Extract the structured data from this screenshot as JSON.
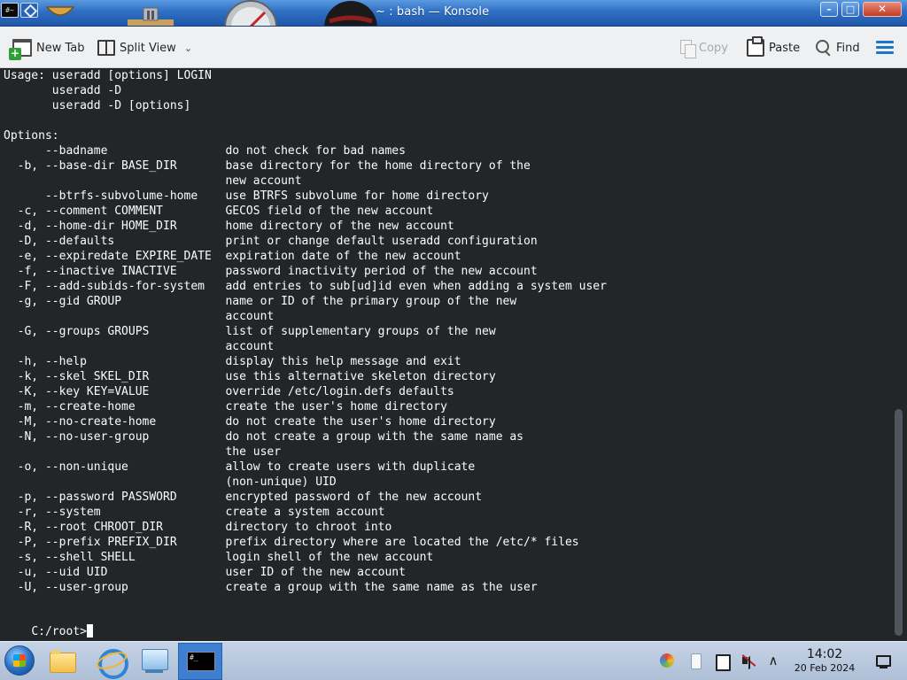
{
  "window": {
    "title": "~ : bash — Konsole",
    "menu_icon_glyph": "#~",
    "minimize_glyph": "–",
    "maximize_glyph": "□",
    "close_glyph": "✕"
  },
  "toolbar": {
    "new_tab": "New Tab",
    "split_view": "Split View",
    "copy": "Copy",
    "paste": "Paste",
    "find": "Find"
  },
  "icons": {
    "new_tab": "new-tab-icon",
    "split_view": "split-view-icon",
    "copy": "copy-icon",
    "paste": "paste-icon",
    "find": "find-icon",
    "menu": "hamburger-menu-icon"
  },
  "colors": {
    "terminal_bg": "#232629",
    "terminal_fg": "#fcfcfc",
    "titlebar_blue": "#2f6fc4",
    "menu_accent": "#1d74c8"
  },
  "terminal": {
    "lines": [
      "Usage: useradd [options] LOGIN",
      "       useradd -D",
      "       useradd -D [options]",
      "",
      "Options:",
      "      --badname                 do not check for bad names",
      "  -b, --base-dir BASE_DIR       base directory for the home directory of the",
      "                                new account",
      "      --btrfs-subvolume-home    use BTRFS subvolume for home directory",
      "  -c, --comment COMMENT         GECOS field of the new account",
      "  -d, --home-dir HOME_DIR       home directory of the new account",
      "  -D, --defaults                print or change default useradd configuration",
      "  -e, --expiredate EXPIRE_DATE  expiration date of the new account",
      "  -f, --inactive INACTIVE       password inactivity period of the new account",
      "  -F, --add-subids-for-system   add entries to sub[ud]id even when adding a system user",
      "  -g, --gid GROUP               name or ID of the primary group of the new",
      "                                account",
      "  -G, --groups GROUPS           list of supplementary groups of the new",
      "                                account",
      "  -h, --help                    display this help message and exit",
      "  -k, --skel SKEL_DIR           use this alternative skeleton directory",
      "  -K, --key KEY=VALUE           override /etc/login.defs defaults",
      "  -m, --create-home             create the user's home directory",
      "  -M, --no-create-home          do not create the user's home directory",
      "  -N, --no-user-group           do not create a group with the same name as",
      "                                the user",
      "  -o, --non-unique              allow to create users with duplicate",
      "                                (non-unique) UID",
      "  -p, --password PASSWORD       encrypted password of the new account",
      "  -r, --system                  create a system account",
      "  -R, --root CHROOT_DIR         directory to chroot into",
      "  -P, --prefix PREFIX_DIR       prefix directory where are located the /etc/* files",
      "  -s, --shell SHELL             login shell of the new account",
      "  -u, --uid UID                 user ID of the new account",
      "  -U, --user-group              create a group with the same name as the user",
      ""
    ],
    "prompt": "C:/root>"
  },
  "taskbar": {
    "items": [
      "start-orb",
      "file-manager-icon",
      "browser-icon",
      "network-icon",
      "terminal-icon"
    ],
    "terminal_glyph": "#_",
    "tray_expand_glyph": "∧",
    "clock_time": "14:02",
    "clock_date": "20 Feb 2024"
  }
}
